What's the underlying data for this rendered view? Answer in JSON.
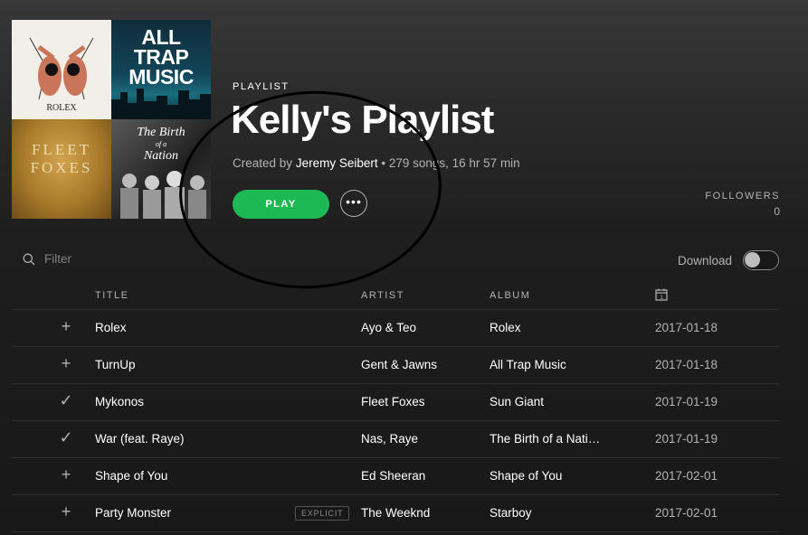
{
  "cover": {
    "tiles": [
      {
        "text": "ROLEX"
      },
      {
        "text_lines": [
          "ALL",
          "TRAP",
          "MUSIC"
        ]
      },
      {
        "text_lines": [
          "FLEET",
          "FOXES"
        ]
      },
      {
        "text_lines": [
          "The Birth",
          "of a",
          "Nation"
        ]
      }
    ]
  },
  "playlist": {
    "type_label": "PLAYLIST",
    "title": "Kelly's Playlist",
    "created_by_prefix": "Created by",
    "creator": "Jeremy Seibert",
    "stats": "• 279 songs, 16 hr 57 min",
    "play_label": "PLAY",
    "more_label": "•••"
  },
  "followers": {
    "label": "FOLLOWERS",
    "count": "0"
  },
  "filter": {
    "placeholder": "Filter"
  },
  "download": {
    "label": "Download",
    "enabled": false
  },
  "columns": {
    "title": "TITLE",
    "artist": "ARTIST",
    "album": "ALBUM"
  },
  "tracks": [
    {
      "action": "+",
      "title": "Rolex",
      "explicit": "",
      "artist": "Ayo & Teo",
      "album": "Rolex",
      "date": "2017-01-18"
    },
    {
      "action": "+",
      "title": "TurnUp",
      "explicit": "",
      "artist": "Gent & Jawns",
      "album": "All Trap Music",
      "date": "2017-01-18"
    },
    {
      "action": "✓",
      "title": "Mykonos",
      "explicit": "",
      "artist": "Fleet Foxes",
      "album": "Sun Giant",
      "date": "2017-01-19"
    },
    {
      "action": "✓",
      "title": "War (feat. Raye)",
      "explicit": "",
      "artist": "Nas, Raye",
      "album": "The Birth of a Nati…",
      "date": "2017-01-19"
    },
    {
      "action": "+",
      "title": "Shape of You",
      "explicit": "",
      "artist": "Ed Sheeran",
      "album": "Shape of You",
      "date": "2017-02-01"
    },
    {
      "action": "+",
      "title": "Party Monster",
      "explicit": "EXPLICIT",
      "artist": "The Weeknd",
      "album": "Starboy",
      "date": "2017-02-01"
    }
  ],
  "colors": {
    "accent": "#1db954",
    "background": "#181818",
    "muted_text": "#b3b3b3"
  }
}
